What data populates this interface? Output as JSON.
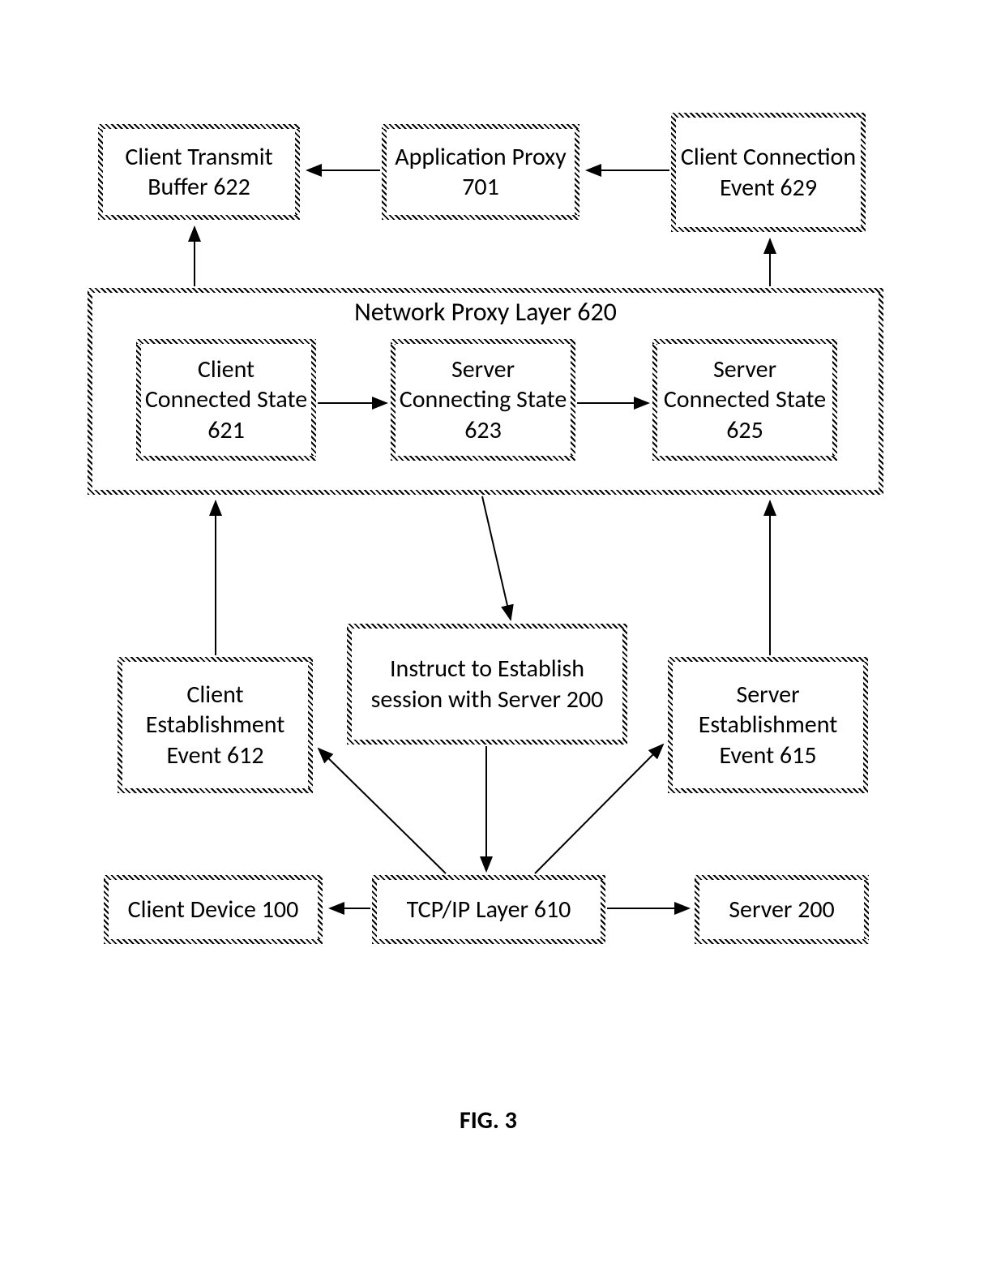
{
  "figure_label": "FIG. 3",
  "boxes": {
    "client_transmit_buffer": "Client Transmit Buffer 622",
    "application_proxy": "Application Proxy 701",
    "client_connection_event": "Client Connection Event 629",
    "network_proxy_layer_title": "Network Proxy Layer 620",
    "client_connected_state": "Client Connected State  621",
    "server_connecting_state": "Server Connecting State 623",
    "server_connected_state": "Server Connected State 625",
    "client_establishment_event": "Client Establishment Event 612",
    "instruct_box": "Instruct to Establish session with Server 200",
    "server_establishment_event": "Server Establishment Event 615",
    "client_device": "Client Device 100",
    "tcp_ip_layer": "TCP/IP Layer 610",
    "server": "Server 200"
  }
}
